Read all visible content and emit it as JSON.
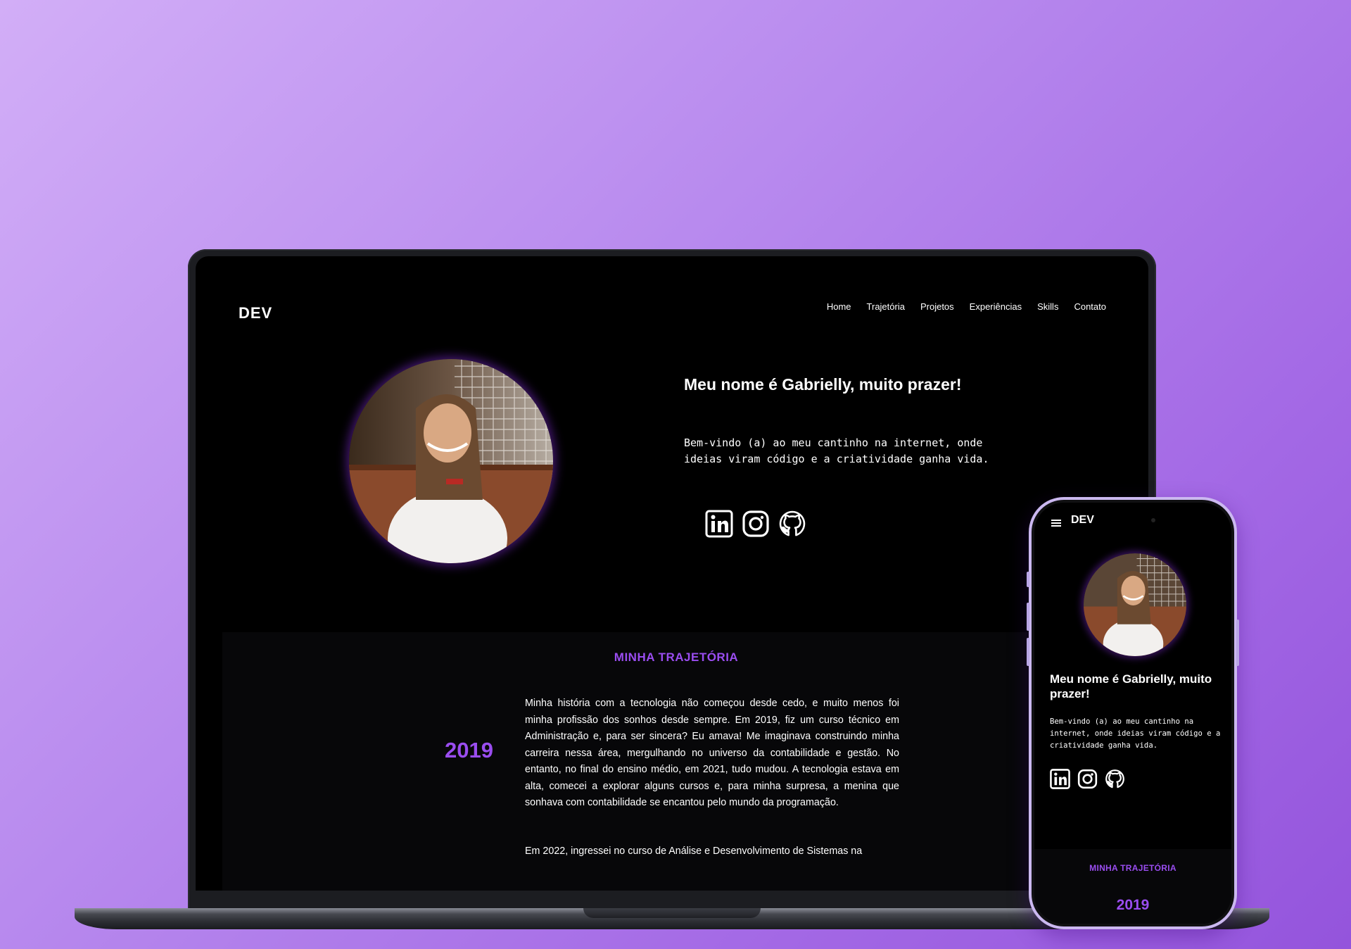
{
  "site": {
    "logo": "DEV",
    "nav": [
      "Home",
      "Trajetória",
      "Projetos",
      "Experiências",
      "Skills",
      "Contato"
    ]
  },
  "hero": {
    "title": "Meu nome é Gabrielly, muito prazer!",
    "subtitle": "Bem-vindo (a) ao meu cantinho na internet, onde ideias viram código e a criatividade ganha vida.",
    "social_icons": [
      "linkedin-icon",
      "instagram-icon",
      "github-icon"
    ]
  },
  "trajectory": {
    "heading": "MINHA TRAJETÓRIA",
    "year": "2019",
    "paragraph1": "Minha história com a tecnologia não começou desde cedo, e muito menos foi minha profissão dos sonhos desde sempre. Em 2019, fiz um curso técnico em Administração e, para ser sincera? Eu amava! Me imaginava construindo minha carreira nessa área, mergulhando no universo da contabilidade e gestão. No entanto, no final do ensino médio, em 2021, tudo mudou. A tecnologia estava em alta, comecei a explorar alguns cursos e, para minha surpresa, a menina que sonhava com contabilidade se encantou pelo mundo da programação.",
    "paragraph2": "Em 2022, ingressei no curso de Análise e Desenvolvimento de Sistemas na"
  },
  "colors": {
    "accent": "#9a4df0",
    "background_gradient_start": "#d2aef7",
    "background_gradient_end": "#9454dc",
    "screen": "#000000"
  }
}
